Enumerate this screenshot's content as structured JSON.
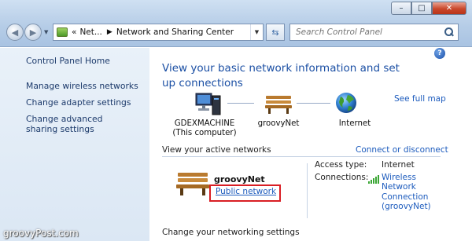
{
  "window": {
    "minimize_glyph": "–",
    "maximize_glyph": "□",
    "close_glyph": "✕"
  },
  "nav": {
    "back_glyph": "◀",
    "forward_glyph": "▶",
    "dropdown_glyph": "▼"
  },
  "address": {
    "overflow": "«",
    "parts": [
      "Net...",
      "Network and Sharing Center"
    ],
    "separator": "▶",
    "dropdown_glyph": "▼"
  },
  "refresh_glyph": "⇆",
  "search": {
    "placeholder": "Search Control Panel"
  },
  "sidebar": {
    "home": "Control Panel Home",
    "items": [
      {
        "label": "Manage wireless networks"
      },
      {
        "label": "Change adapter settings"
      },
      {
        "label": "Change advanced sharing settings"
      }
    ]
  },
  "help_glyph": "?",
  "main": {
    "heading": "View your basic network information and set up connections",
    "see_full_map": "See full map",
    "map": {
      "computer": {
        "name": "GDEXMACHINE",
        "sub": "(This computer)"
      },
      "network": {
        "name": "groovyNet"
      },
      "internet": {
        "name": "Internet"
      }
    },
    "active_networks_label": "View your active networks",
    "connect_disconnect": "Connect or disconnect",
    "active_network": {
      "name": "groovyNet",
      "type_link": "Public network",
      "access_type_label": "Access type:",
      "access_type_value": "Internet",
      "connections_label": "Connections:",
      "connection_link": "Wireless Network Connection (groovyNet)"
    },
    "change_settings_heading": "Change your networking settings"
  },
  "watermark": "groovyPost.com",
  "colors": {
    "link": "#1c5bbd",
    "heading": "#1b4fa4",
    "highlight_box": "#d91e24",
    "sidebar_bg": "#e1ebf6"
  }
}
